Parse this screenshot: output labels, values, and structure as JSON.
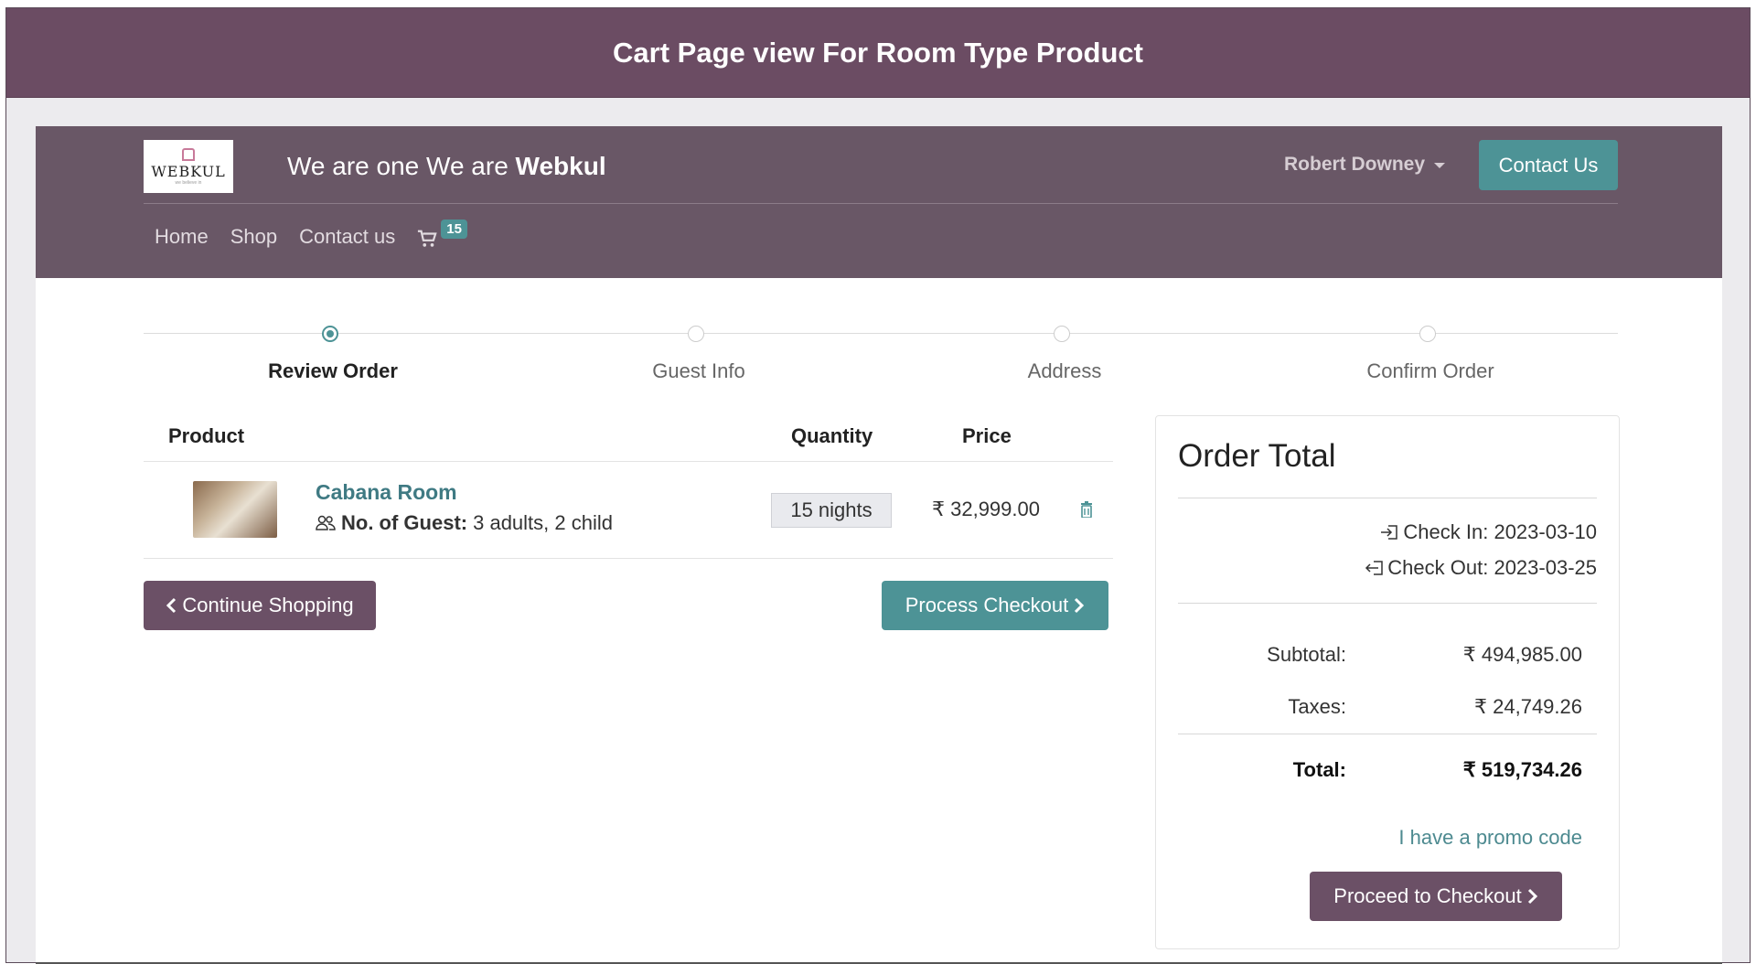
{
  "banner": {
    "title": "Cart Page view For Room Type Product"
  },
  "header": {
    "logo_text": "WEBKUL",
    "logo_sub": "we believe in",
    "tagline_prefix": "We are one We are ",
    "tagline_brand": "Webkul",
    "user_name": "Robert Downey",
    "contact_button": "Contact Us"
  },
  "nav": {
    "items": [
      "Home",
      "Shop",
      "Contact us"
    ],
    "cart_count": "15"
  },
  "steps": [
    "Review Order",
    "Guest Info",
    "Address",
    "Confirm Order"
  ],
  "table": {
    "headers": {
      "product": "Product",
      "quantity": "Quantity",
      "price": "Price"
    },
    "row": {
      "name": "Cabana Room",
      "guest_label": "No. of Guest:",
      "guest_value": "3 adults, 2 child",
      "quantity": "15 nights",
      "price": "₹ 32,999.00"
    }
  },
  "actions": {
    "continue_shopping": "Continue Shopping",
    "process_checkout": "Process Checkout"
  },
  "summary": {
    "title": "Order Total",
    "check_in": "Check In: 2023-03-10",
    "check_out": "Check Out: 2023-03-25",
    "subtotal_label": "Subtotal:",
    "subtotal_value": "₹ 494,985.00",
    "taxes_label": "Taxes:",
    "taxes_value": "₹ 24,749.26",
    "total_label": "Total:",
    "total_value": "₹ 519,734.26",
    "promo": "I have a promo code",
    "proceed": "Proceed to Checkout"
  },
  "colors": {
    "brand": "#6b4c63",
    "accent": "#4d9396"
  }
}
